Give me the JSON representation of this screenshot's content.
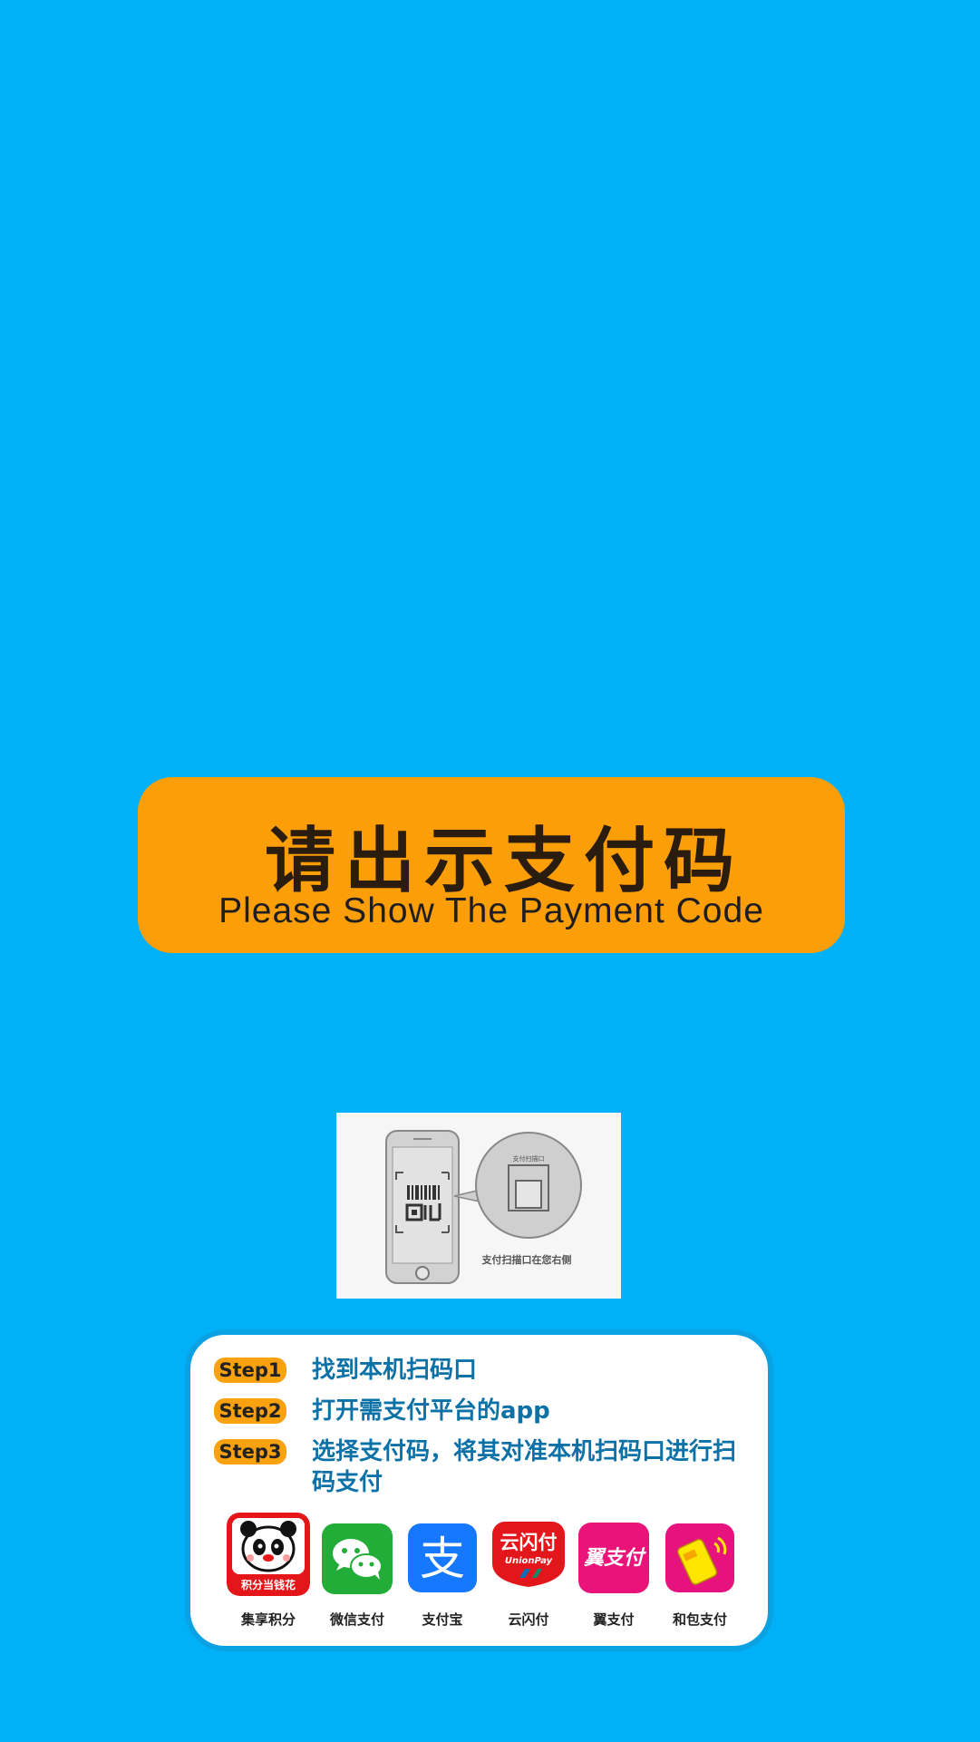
{
  "banner": {
    "title_cn": "请出示支付码",
    "title_en": "Please Show The Payment Code"
  },
  "illustration": {
    "scanner_label": "支付扫描口",
    "caption": "支付扫描口在您右侧"
  },
  "steps": [
    {
      "badge": "Step1",
      "text": "找到本机扫码口"
    },
    {
      "badge": "Step2",
      "text": "打开需支付平台的app"
    },
    {
      "badge": "Step3",
      "text": "选择支付码，将其对准本机扫码口进行扫码支付"
    }
  ],
  "apps": [
    {
      "label": "集享积分",
      "icon_text": "积分当钱花",
      "icon": "panda-icon",
      "color": "#e4161a"
    },
    {
      "label": "微信支付",
      "icon": "wechat-pay-icon",
      "color": "#22ac38"
    },
    {
      "label": "支付宝",
      "icon_text": "支",
      "icon": "alipay-icon",
      "color": "#1677ff"
    },
    {
      "label": "云闪付",
      "icon_text": "云闪付",
      "icon_subtext": "UnionPay",
      "icon": "unionpay-icon",
      "color": "#e3171b"
    },
    {
      "label": "翼支付",
      "icon_text": "翼支付",
      "icon": "bestpay-icon",
      "color": "#e9137a"
    },
    {
      "label": "和包支付",
      "icon": "hebao-icon",
      "color": "#e6127d"
    }
  ],
  "colors": {
    "background": "#01b1f7",
    "banner": "#fc9e07",
    "step_text": "#0c71a6",
    "card_border": "#0aa2e3"
  }
}
